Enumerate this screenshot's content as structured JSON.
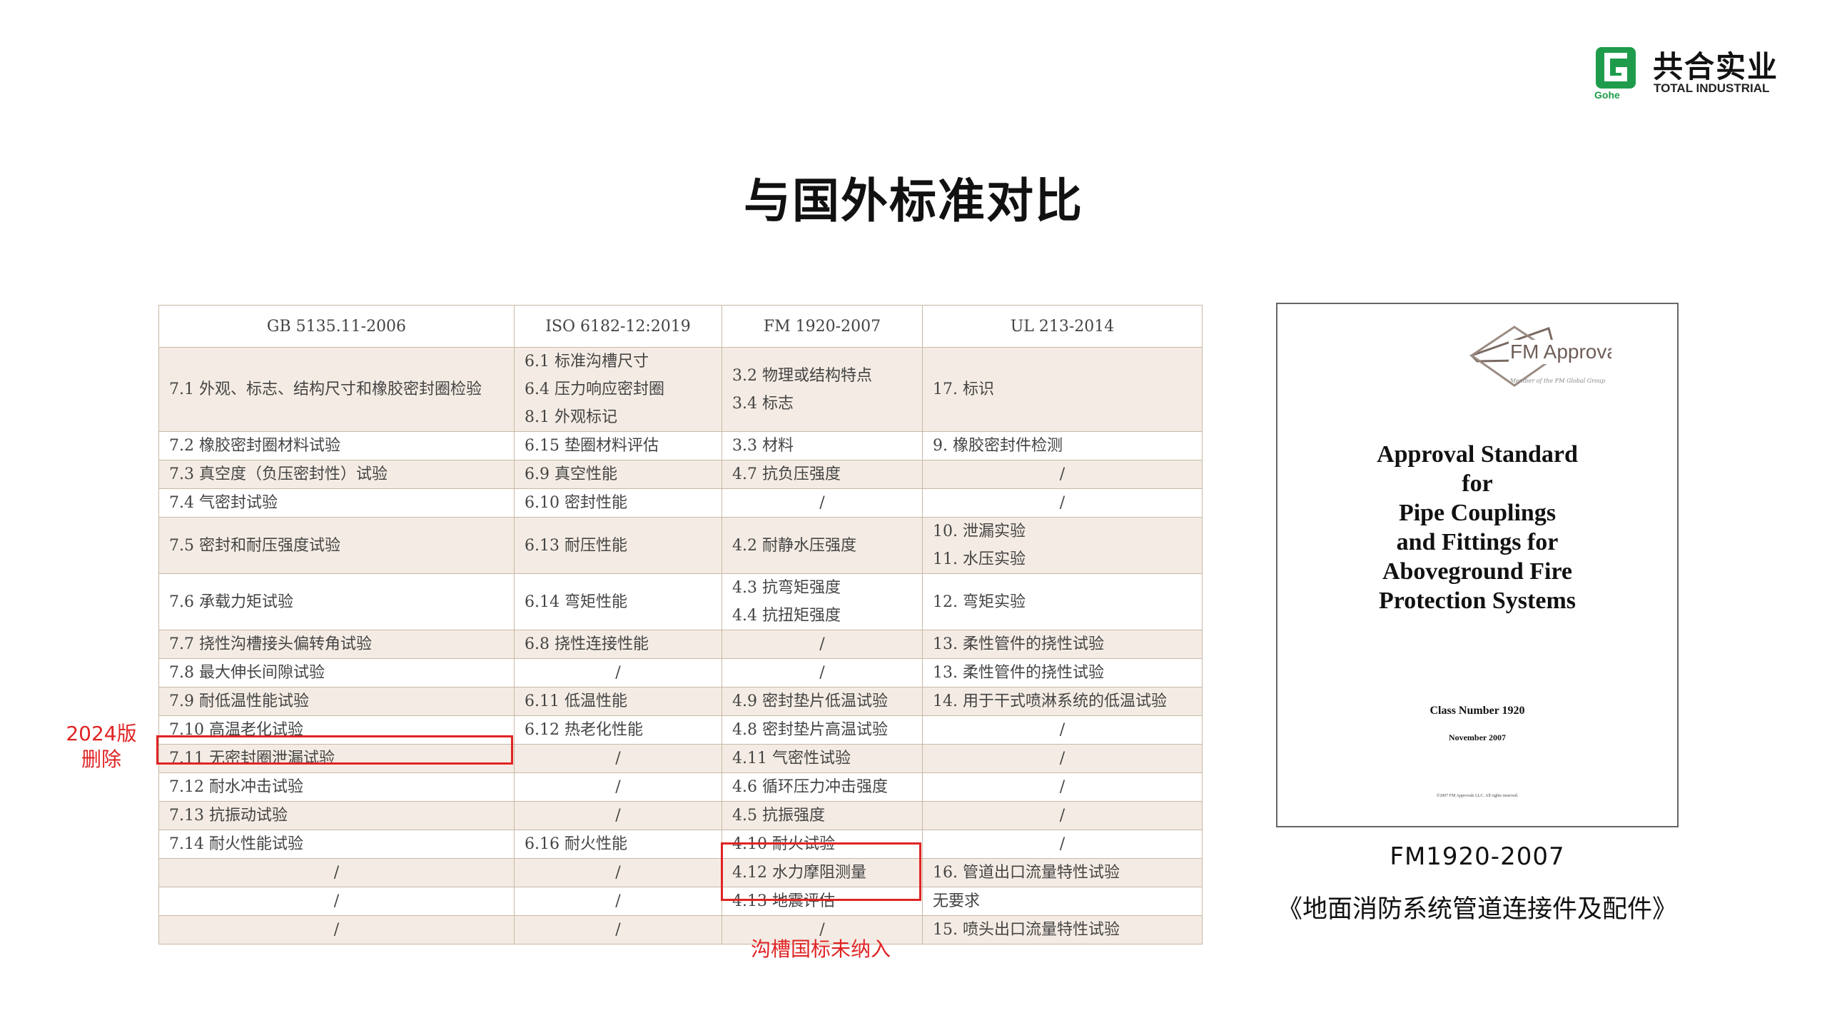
{
  "logo": {
    "cn": "共合实业",
    "en": "TOTAL INDUSTRIAL",
    "mark_text": "Gohe",
    "brand_color": "#1e9c4b"
  },
  "title": "与国外标准对比",
  "table": {
    "headers": [
      "GB 5135.11-2006",
      "ISO 6182-12:2019",
      "FM 1920-2007",
      "UL 213-2014"
    ],
    "rows": [
      {
        "shaded": true,
        "cells": [
          [
            "7.1 外观、标志、结构尺寸和橡胶密封圈检验"
          ],
          [
            "6.1 标准沟槽尺寸",
            "6.4 压力响应密封圈",
            "8.1 外观标记"
          ],
          [
            "3.2 物理或结构特点",
            "3.4 标志"
          ],
          [
            "17. 标识"
          ]
        ]
      },
      {
        "shaded": false,
        "cells": [
          [
            "7.2 橡胶密封圈材料试验"
          ],
          [
            "6.15 垫圈材料评估"
          ],
          [
            "3.3 材料"
          ],
          [
            "9. 橡胶密封件检测"
          ]
        ]
      },
      {
        "shaded": true,
        "cells": [
          [
            "7.3 真空度（负压密封性）试验"
          ],
          [
            "6.9 真空性能"
          ],
          [
            "4.7 抗负压强度"
          ],
          [
            "/"
          ]
        ]
      },
      {
        "shaded": false,
        "cells": [
          [
            "7.4 气密封试验"
          ],
          [
            "6.10 密封性能"
          ],
          [
            "/"
          ],
          [
            "/"
          ]
        ]
      },
      {
        "shaded": true,
        "cells": [
          [
            "7.5 密封和耐压强度试验"
          ],
          [
            "6.13 耐压性能"
          ],
          [
            "4.2 耐静水压强度"
          ],
          [
            "10. 泄漏实验",
            "11. 水压实验"
          ]
        ]
      },
      {
        "shaded": false,
        "cells": [
          [
            "7.6 承载力矩试验"
          ],
          [
            "6.14 弯矩性能"
          ],
          [
            "4.3 抗弯矩强度",
            "4.4 抗扭矩强度"
          ],
          [
            "12. 弯矩实验"
          ]
        ]
      },
      {
        "shaded": true,
        "cells": [
          [
            "7.7 挠性沟槽接头偏转角试验"
          ],
          [
            "6.8 挠性连接性能"
          ],
          [
            "/"
          ],
          [
            "13. 柔性管件的挠性试验"
          ]
        ]
      },
      {
        "shaded": false,
        "cells": [
          [
            "7.8 最大伸长间隙试验"
          ],
          [
            "/"
          ],
          [
            "/"
          ],
          [
            "13. 柔性管件的挠性试验"
          ]
        ]
      },
      {
        "shaded": true,
        "cells": [
          [
            "7.9 耐低温性能试验"
          ],
          [
            "6.11 低温性能"
          ],
          [
            "4.9 密封垫片低温试验"
          ],
          [
            "14. 用于干式喷淋系统的低温试验"
          ]
        ]
      },
      {
        "shaded": false,
        "cells": [
          [
            "7.10 高温老化试验"
          ],
          [
            "6.12 热老化性能"
          ],
          [
            "4.8 密封垫片高温试验"
          ],
          [
            "/"
          ]
        ]
      },
      {
        "shaded": true,
        "cells": [
          [
            "7.11 无密封圈泄漏试验"
          ],
          [
            "/"
          ],
          [
            "4.11 气密性试验"
          ],
          [
            "/"
          ]
        ]
      },
      {
        "shaded": false,
        "cells": [
          [
            "7.12 耐水冲击试验"
          ],
          [
            "/"
          ],
          [
            "4.6 循环压力冲击强度"
          ],
          [
            "/"
          ]
        ]
      },
      {
        "shaded": true,
        "cells": [
          [
            "7.13 抗振动试验"
          ],
          [
            "/"
          ],
          [
            "4.5 抗振强度"
          ],
          [
            "/"
          ]
        ]
      },
      {
        "shaded": false,
        "cells": [
          [
            "7.14 耐火性能试验"
          ],
          [
            "6.16 耐火性能"
          ],
          [
            "4.10 耐火试验"
          ],
          [
            "/"
          ]
        ]
      },
      {
        "shaded": true,
        "cells": [
          [
            "/"
          ],
          [
            "/"
          ],
          [
            "4.12 水力摩阻测量"
          ],
          [
            "16. 管道出口流量特性试验"
          ]
        ]
      },
      {
        "shaded": false,
        "cells": [
          [
            "/"
          ],
          [
            "/"
          ],
          [
            "4.13 地震评估"
          ],
          [
            "无要求"
          ]
        ]
      },
      {
        "shaded": true,
        "cells": [
          [
            "/"
          ],
          [
            "/"
          ],
          [
            "/"
          ],
          [
            "15. 喷头出口流量特性试验"
          ]
        ]
      }
    ]
  },
  "annotations": {
    "deleted_2024": [
      "2024版",
      "删除"
    ],
    "groove_not_included": "沟槽国标未纳入",
    "highlight_color": "#e02424"
  },
  "cover": {
    "fm_logo_text": "FM Approvals",
    "fm_member_text": "Member of the FM Global Group",
    "title_lines": [
      "Approval Standard",
      "for",
      "Pipe Couplings",
      "and Fittings for",
      "Aboveground Fire",
      "Protection Systems"
    ],
    "class_number": "Class Number 1920",
    "date": "November 2007",
    "copyright": "©2007 FM Approvals LLC. All rights reserved."
  },
  "caption": {
    "code": "FM1920-2007",
    "name": "《地面消防系统管道连接件及配件》"
  }
}
